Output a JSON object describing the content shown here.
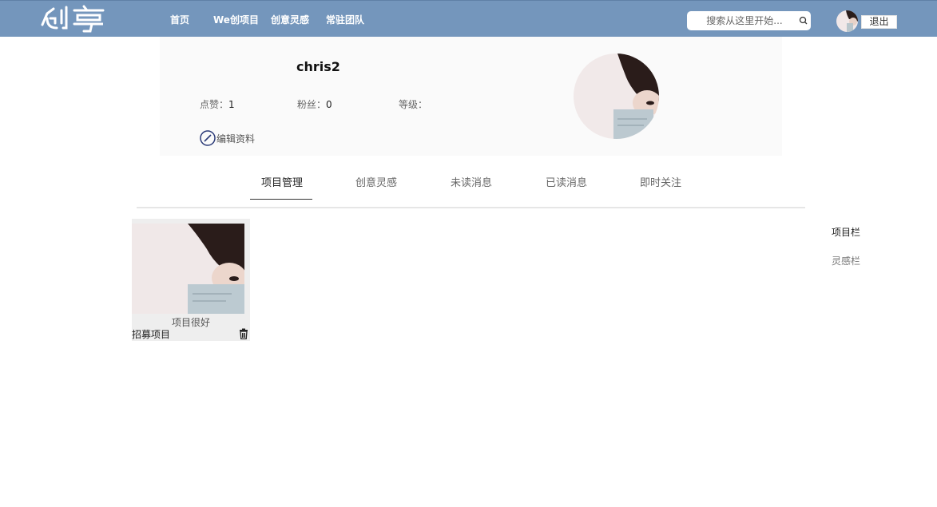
{
  "header": {
    "logo_text": "创享",
    "nav": [
      {
        "label": "首页"
      },
      {
        "label": "We创项目"
      },
      {
        "label": "创意灵感"
      },
      {
        "label": "常驻团队"
      }
    ],
    "search_placeholder": "搜索从这里开始...",
    "logout_label": "退出"
  },
  "profile": {
    "username": "chris2",
    "likes_label": "点赞：",
    "likes_value": "1",
    "fans_label": "粉丝：",
    "fans_value": "0",
    "level_label": "等级：",
    "level_value": "",
    "edit_label": "编辑资料"
  },
  "tabs": [
    {
      "label": "项目管理",
      "active": true
    },
    {
      "label": "创意灵感"
    },
    {
      "label": "未读消息"
    },
    {
      "label": "已读消息"
    },
    {
      "label": "即时关注"
    }
  ],
  "side": {
    "projects_label": "项目栏",
    "inspiration_label": "灵感栏"
  },
  "projects": [
    {
      "description": "项目很好",
      "type": "招募项目"
    }
  ],
  "colors": {
    "topbar": "#7496bc",
    "profile_bg": "#fafafa",
    "card_bg": "#eeeeee",
    "edit_icon": "#2b3a78"
  }
}
